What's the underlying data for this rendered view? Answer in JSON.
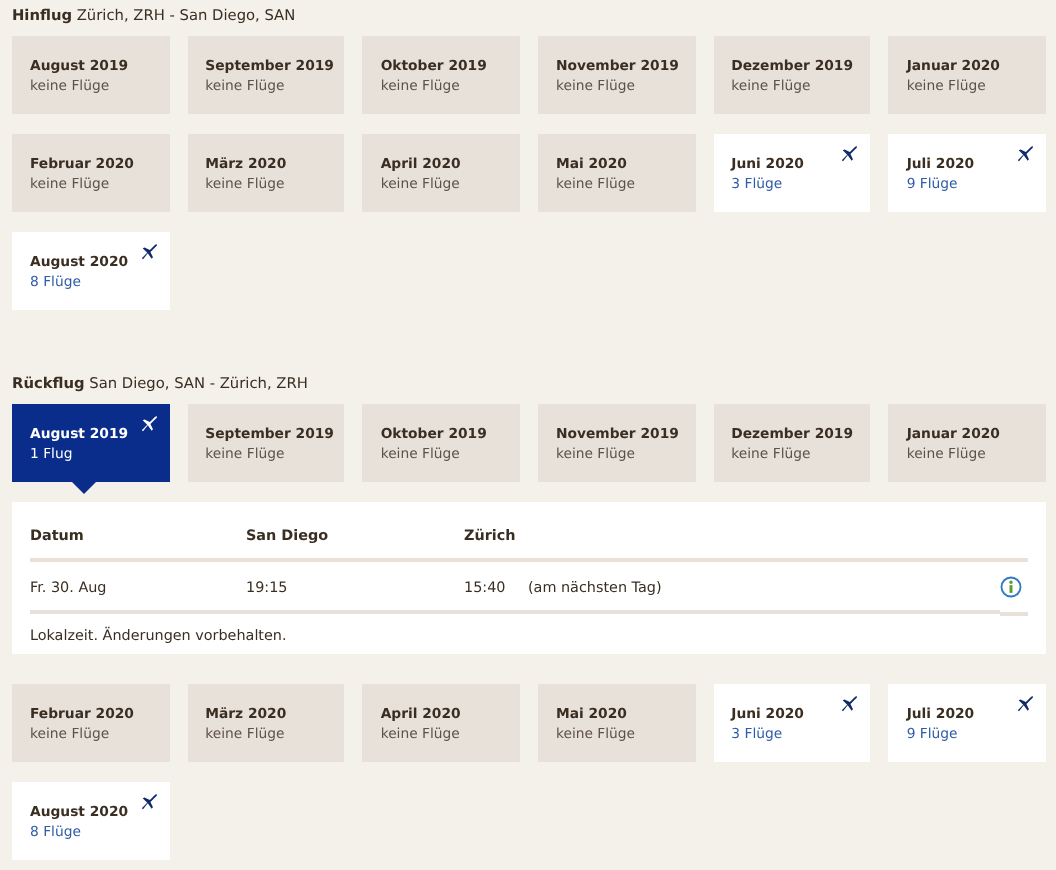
{
  "outbound": {
    "heading": "**Hinflug** Zürich, ZRH - San Diego, SAN",
    "months": [
      {
        "month": "August 2019",
        "flights": "keine Flüge",
        "available": false,
        "selected": false
      },
      {
        "month": "September 2019",
        "flights": "keine Flüge",
        "available": false,
        "selected": false
      },
      {
        "month": "Oktober 2019",
        "flights": "keine Flüge",
        "available": false,
        "selected": false
      },
      {
        "month": "November 2019",
        "flights": "keine Flüge",
        "available": false,
        "selected": false
      },
      {
        "month": "Dezember 2019",
        "flights": "keine Flüge",
        "available": false,
        "selected": false
      },
      {
        "month": "Januar 2020",
        "flights": "keine Flüge",
        "available": false,
        "selected": false
      },
      {
        "month": "Februar 2020",
        "flights": "keine Flüge",
        "available": false,
        "selected": false
      },
      {
        "month": "März 2020",
        "flights": "keine Flüge",
        "available": false,
        "selected": false
      },
      {
        "month": "April 2020",
        "flights": "keine Flüge",
        "available": false,
        "selected": false
      },
      {
        "month": "Mai 2020",
        "flights": "keine Flüge",
        "available": false,
        "selected": false
      },
      {
        "month": "Juni 2020",
        "flights": "3 Flüge",
        "available": true,
        "selected": false
      },
      {
        "month": "Juli 2020",
        "flights": "9 Flüge",
        "available": true,
        "selected": false
      },
      {
        "month": "August 2020",
        "flights": "8 Flüge",
        "available": true,
        "selected": false
      }
    ]
  },
  "return": {
    "heading": "**Rückflug** San Diego, SAN - Zürich, ZRH",
    "months": [
      {
        "month": "August 2019",
        "flights": "1 Flug",
        "available": true,
        "selected": true
      },
      {
        "month": "September 2019",
        "flights": "keine Flüge",
        "available": false,
        "selected": false
      },
      {
        "month": "Oktober 2019",
        "flights": "keine Flüge",
        "available": false,
        "selected": false
      },
      {
        "month": "November 2019",
        "flights": "keine Flüge",
        "available": false,
        "selected": false
      },
      {
        "month": "Dezember 2019",
        "flights": "keine Flüge",
        "available": false,
        "selected": false
      },
      {
        "month": "Januar 2020",
        "flights": "keine Flüge",
        "available": false,
        "selected": false
      },
      {
        "month": "Februar 2020",
        "flights": "keine Flüge",
        "available": false,
        "selected": false
      },
      {
        "month": "März 2020",
        "flights": "keine Flüge",
        "available": false,
        "selected": false
      },
      {
        "month": "April 2020",
        "flights": "keine Flüge",
        "available": false,
        "selected": false
      },
      {
        "month": "Mai 2020",
        "flights": "keine Flüge",
        "available": false,
        "selected": false
      },
      {
        "month": "Juni 2020",
        "flights": "3 Flüge",
        "available": true,
        "selected": false
      },
      {
        "month": "Juli 2020",
        "flights": "9 Flüge",
        "available": true,
        "selected": false
      },
      {
        "month": "August 2020",
        "flights": "8 Flüge",
        "available": true,
        "selected": false
      }
    ],
    "detail": {
      "columns": [
        "Datum",
        "San Diego",
        "Zürich"
      ],
      "rows": [
        {
          "date": "Fr. 30. Aug",
          "departure": "19:15",
          "arrival": "15:40",
          "arrival_note": "(am nächsten Tag)"
        }
      ],
      "note": "Lokalzeit. Änderungen vorbehalten."
    }
  }
}
